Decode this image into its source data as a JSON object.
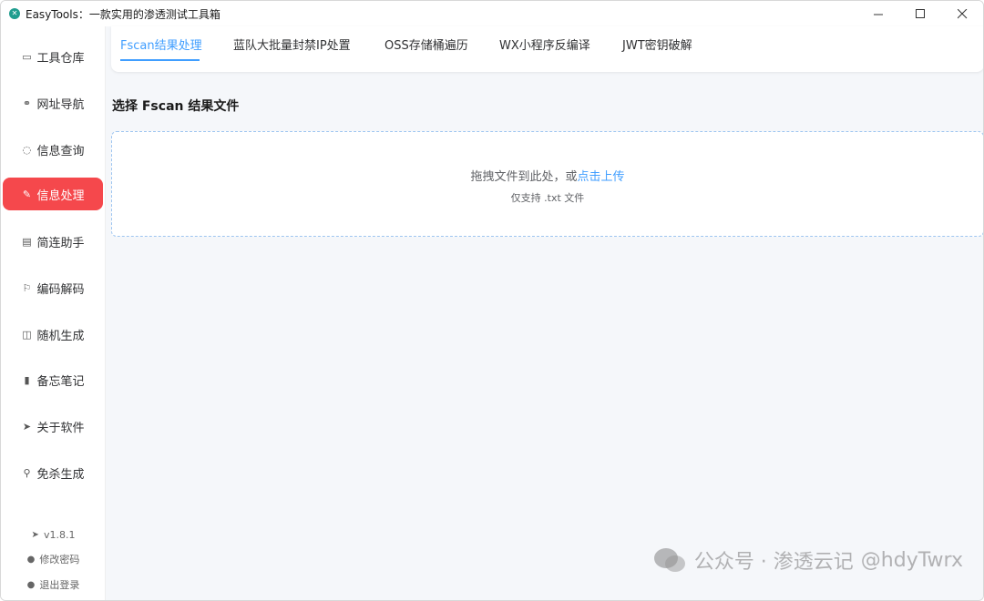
{
  "window": {
    "title": "EasyTools：一款实用的渗透测试工具箱",
    "controls": {
      "minimize": "–",
      "maximize": "☐",
      "close": "✕"
    }
  },
  "sidebar": {
    "items": [
      {
        "label": "工具仓库",
        "icon": "box-icon",
        "glyph": "▭",
        "active": false
      },
      {
        "label": "网址导航",
        "icon": "link-icon",
        "glyph": "⚭",
        "active": false
      },
      {
        "label": "信息查询",
        "icon": "chat-icon",
        "glyph": "◌",
        "active": false
      },
      {
        "label": "信息处理",
        "icon": "edit-icon",
        "glyph": "✎",
        "active": true
      },
      {
        "label": "简连助手",
        "icon": "document-icon",
        "glyph": "▤",
        "active": false
      },
      {
        "label": "编码解码",
        "icon": "flag-icon",
        "glyph": "⚐",
        "active": false
      },
      {
        "label": "随机生成",
        "icon": "shield-icon",
        "glyph": "◫",
        "active": false
      },
      {
        "label": "备忘笔记",
        "icon": "notebook-icon",
        "glyph": "▮",
        "active": false
      },
      {
        "label": "关于软件",
        "icon": "send-icon",
        "glyph": "➤",
        "active": false
      },
      {
        "label": "免杀生成",
        "icon": "paperclip-icon",
        "glyph": "⚲",
        "active": false
      }
    ],
    "footer": {
      "version": "v1.8.1",
      "change_password": "修改密码",
      "logout": "退出登录"
    }
  },
  "tabs": [
    {
      "label": "Fscan结果处理",
      "active": true
    },
    {
      "label": "蓝队大批量封禁IP处置",
      "active": false
    },
    {
      "label": "OSS存储桶遍历",
      "active": false
    },
    {
      "label": "WX小程序反编译",
      "active": false
    },
    {
      "label": "JWT密钥破解",
      "active": false
    }
  ],
  "main": {
    "section_title": "选择 Fscan 结果文件",
    "upload": {
      "prompt": "拖拽文件到此处，或",
      "link": "点击上传",
      "tip": "仅支持 .txt 文件"
    }
  },
  "watermark": {
    "text": "公众号 · 渗透云记",
    "handle": "@hdyTwrx"
  },
  "colors": {
    "accent": "#409eff",
    "active_nav": "#f5484c",
    "background": "#f5f7fa"
  }
}
